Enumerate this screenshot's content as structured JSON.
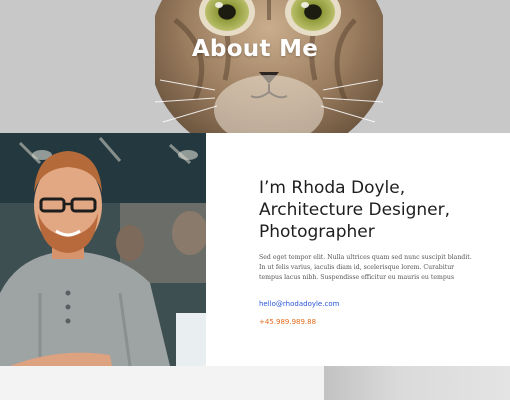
{
  "hero": {
    "title": "About Me"
  },
  "about": {
    "headline": "I’m Rhoda Doyle, Architecture Designer, Photographer",
    "bio": "Sed eget tempor elit. Nulla ultrices quam sed nunc suscipit blandit. In ut felis varius, iaculis diam id, scelerisque lorem. Curabitur tempus lacus nibh. Suspendisse efficitur eu mauris eu tempus",
    "email": "hello@rhodadoyle.com",
    "phone": "+45.989.989.88"
  },
  "colors": {
    "hero_bg": "#c8c8c8",
    "email_link": "#2b55d9",
    "phone_link": "#e36a1c",
    "heading_text": "#1e1e1e"
  }
}
